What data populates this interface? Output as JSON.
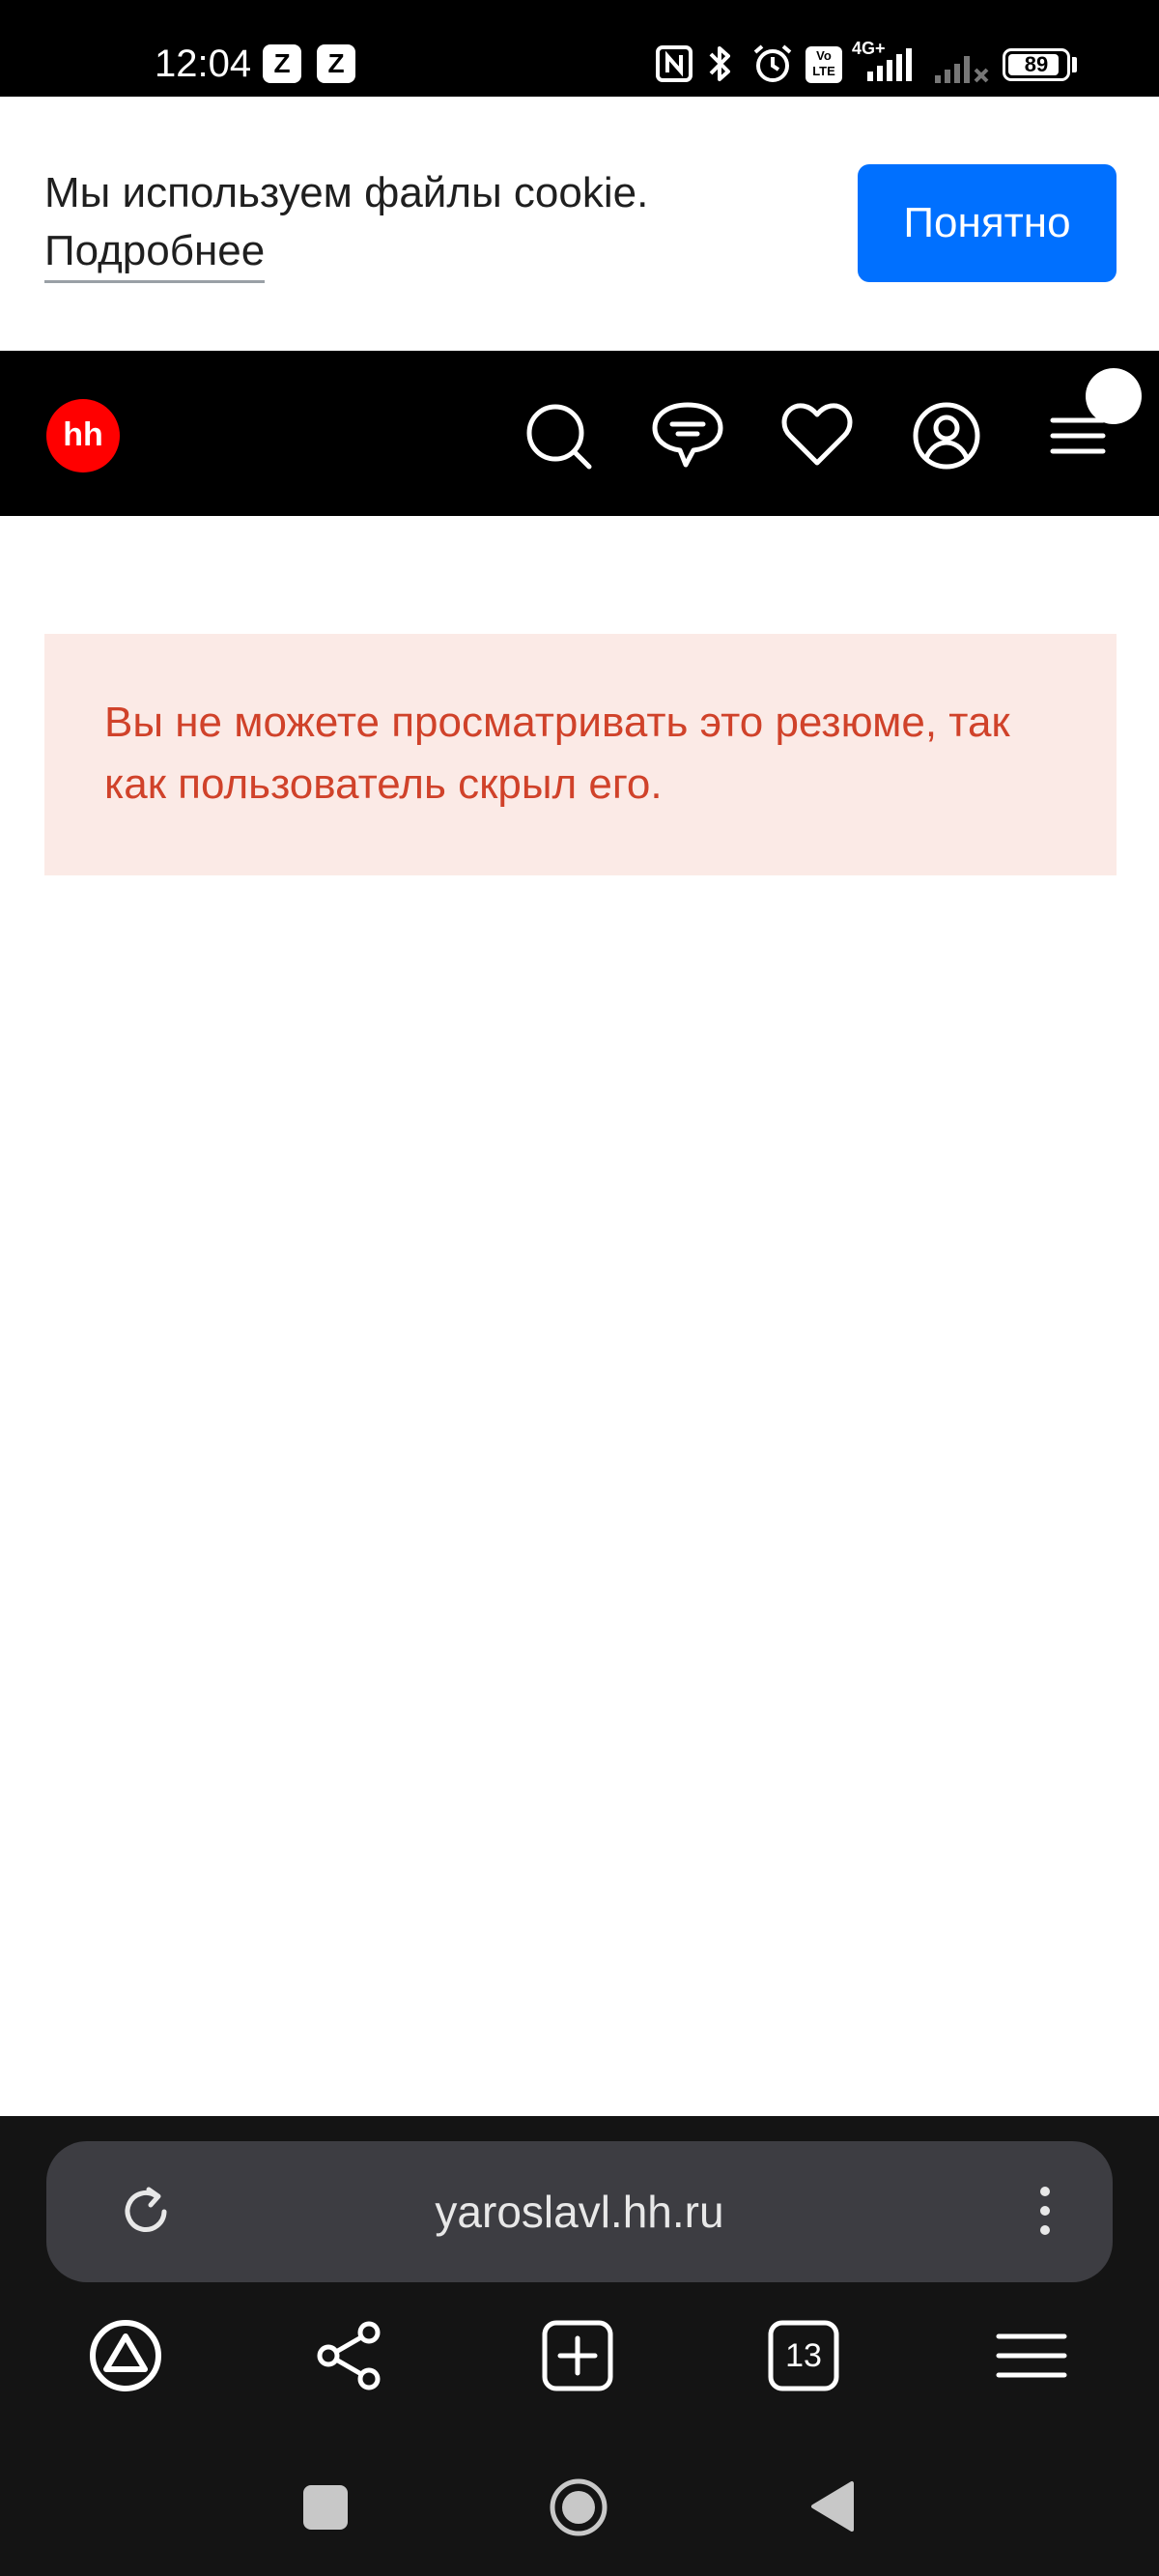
{
  "status_bar": {
    "time": "12:04",
    "notification_icons": [
      "z-app-icon",
      "z-app-icon"
    ],
    "system_icons": [
      "nfc-icon",
      "bluetooth-icon",
      "alarm-icon",
      "volte-icon",
      "signal-4g-icon",
      "signal-no-service-icon"
    ],
    "network_label": "4G+",
    "volte_label": "Vo LTE",
    "battery_level": "89",
    "battery_fraction": 0.89
  },
  "cookie_banner": {
    "message": "Мы используем файлы cookie.",
    "more_link": "Подробнее",
    "accept_button": "Понятно"
  },
  "header": {
    "logo_text": "hh",
    "icons": [
      "search-icon",
      "chat-icon",
      "favorites-heart-icon",
      "profile-icon",
      "menu-icon"
    ]
  },
  "error": {
    "message": "Вы не можете просматривать это резюме, так как пользователь скрыл его."
  },
  "browser": {
    "url": "yaroslavl.hh.ru",
    "tab_count": "13",
    "toolbar_icons": [
      "alice-icon",
      "share-icon",
      "new-tab-icon",
      "tabs-icon",
      "browser-menu-icon"
    ]
  },
  "android_nav": [
    "recents-button",
    "home-button",
    "back-button"
  ],
  "colors": {
    "accent_blue": "#0070ff",
    "hh_red": "#ff0000",
    "error_text": "#d0422a",
    "error_bg": "#fbeae6"
  }
}
